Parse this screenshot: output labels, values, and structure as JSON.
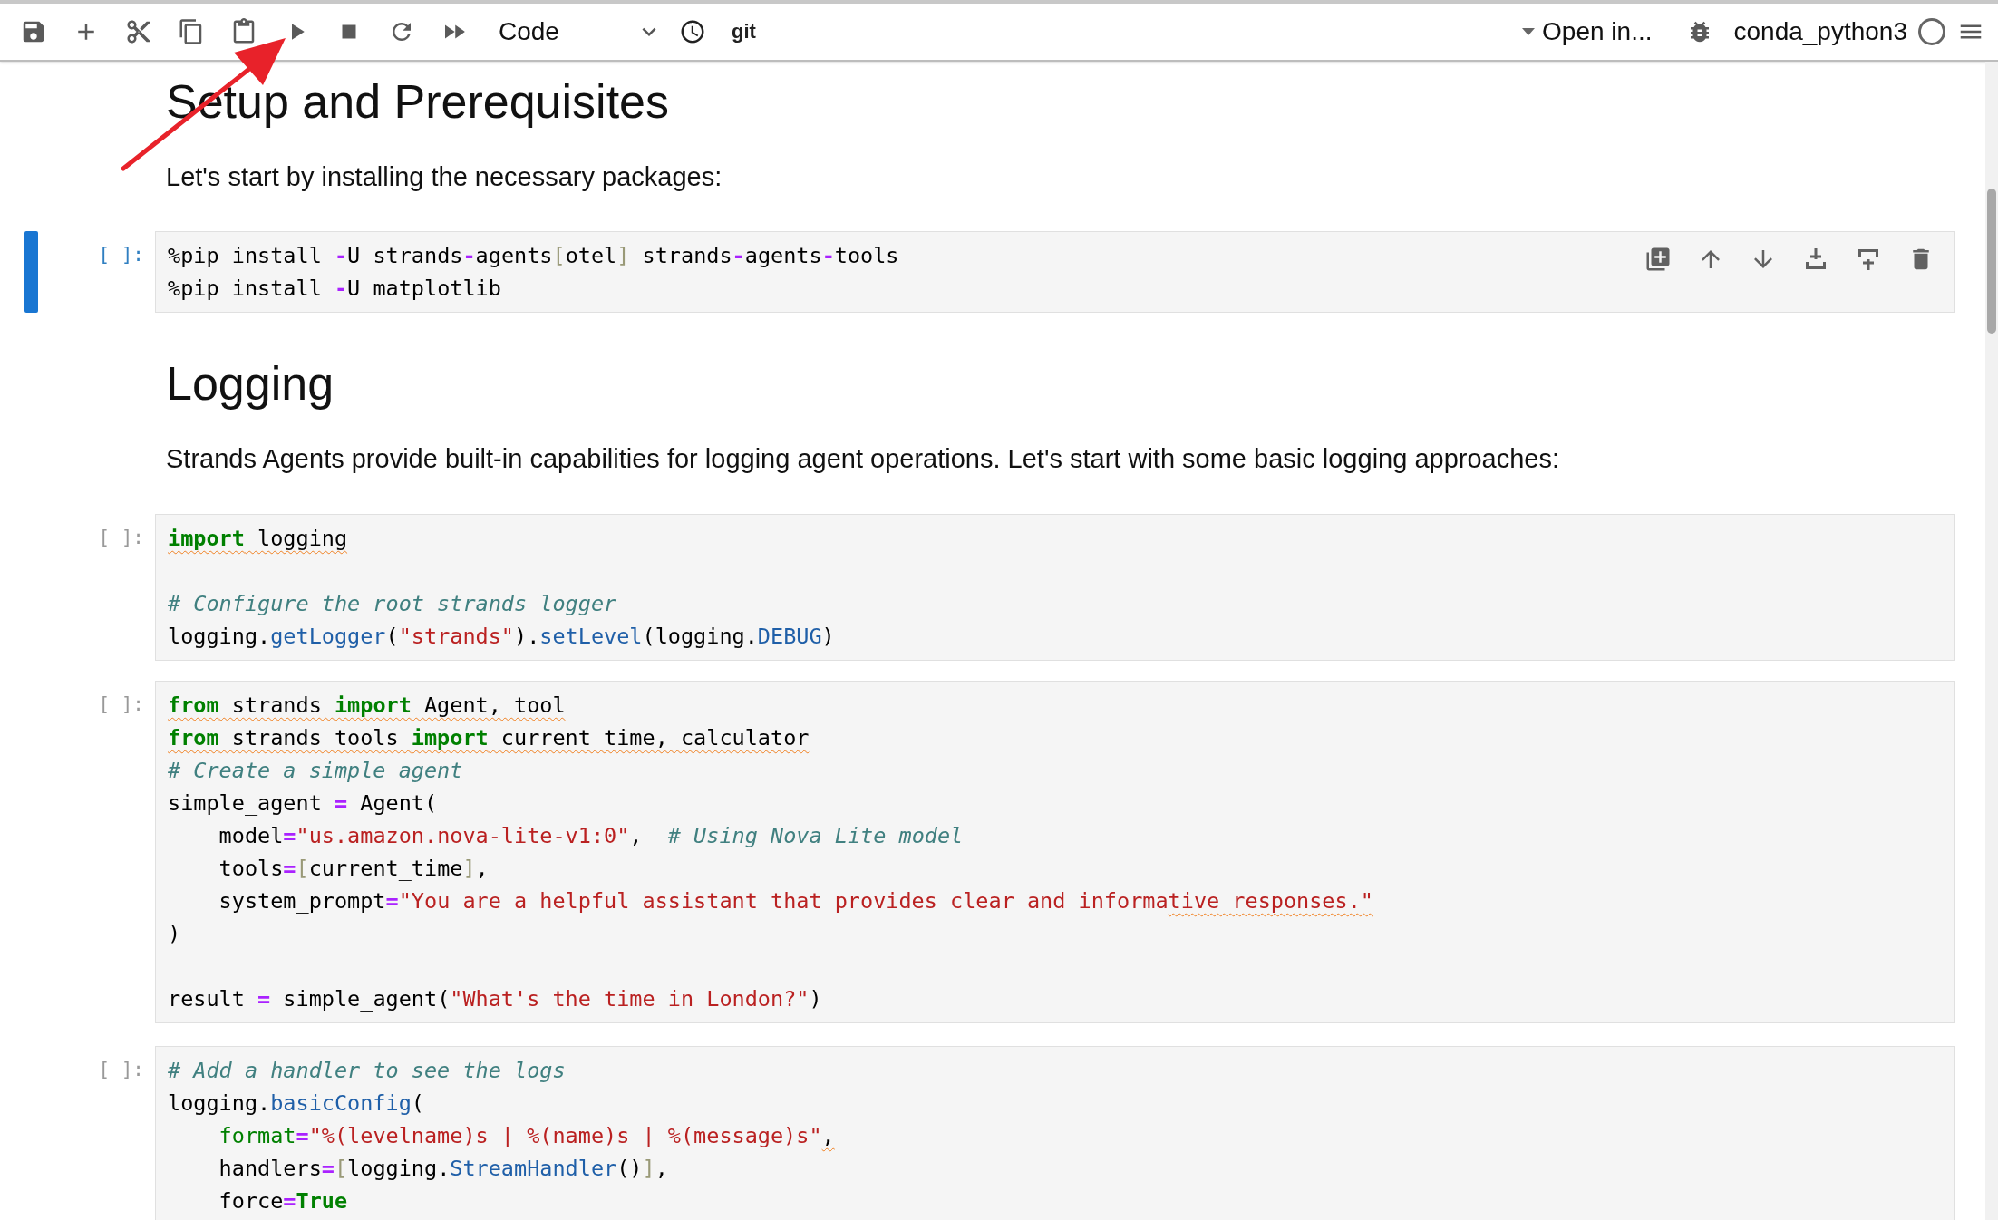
{
  "toolbar": {
    "cell_type": "Code",
    "git": "git",
    "open_in": "Open in...",
    "kernel": "conda_python3",
    "kernel_busy": false
  },
  "cells": [
    {
      "kind": "markdown",
      "heading": "Setup and Prerequisites",
      "text": "Let's start by installing the necessary packages:"
    },
    {
      "kind": "code",
      "prompt": "[ ]:",
      "active": true,
      "lines": [
        {
          "kind": "code",
          "tokens": [
            {
              "text": "%pip install ",
              "kind": "plain",
              "squiggle": false
            },
            {
              "text": "-",
              "kind": "op",
              "squiggle": false
            },
            {
              "text": "U strands",
              "kind": "plain",
              "squiggle": false
            },
            {
              "text": "-",
              "kind": "op",
              "squiggle": false
            },
            {
              "text": "agents",
              "kind": "plain",
              "squiggle": false
            },
            {
              "text": "[",
              "kind": "bracket",
              "squiggle": false
            },
            {
              "text": "otel",
              "kind": "plain",
              "squiggle": false
            },
            {
              "text": "]",
              "kind": "bracket",
              "squiggle": false
            },
            {
              "text": " strands",
              "kind": "plain",
              "squiggle": false
            },
            {
              "text": "-",
              "kind": "op",
              "squiggle": false
            },
            {
              "text": "agents",
              "kind": "plain",
              "squiggle": false
            },
            {
              "text": "-",
              "kind": "op",
              "squiggle": false
            },
            {
              "text": "tools",
              "kind": "plain",
              "squiggle": false
            }
          ]
        },
        {
          "kind": "code",
          "tokens": [
            {
              "text": "%pip install ",
              "kind": "plain",
              "squiggle": false
            },
            {
              "text": "-",
              "kind": "op",
              "squiggle": false
            },
            {
              "text": "U matplotlib",
              "kind": "plain",
              "squiggle": false
            }
          ]
        }
      ]
    },
    {
      "kind": "markdown",
      "heading": "Logging",
      "text": "Strands Agents provide built-in capabilities for logging agent operations. Let's start with some basic logging approaches:"
    },
    {
      "kind": "code",
      "prompt": "[ ]:",
      "active": false,
      "lines": [
        {
          "kind": "code",
          "tokens": [
            {
              "text": "import",
              "kind": "keyword",
              "squiggle": true
            },
            {
              "text": " logging",
              "kind": "plain",
              "squiggle": true
            }
          ]
        },
        {
          "kind": "blank"
        },
        {
          "kind": "code",
          "tokens": [
            {
              "text": "# Configure the root strands logger",
              "kind": "comment",
              "squiggle": false
            }
          ]
        },
        {
          "kind": "code",
          "tokens": [
            {
              "text": "logging.",
              "kind": "plain",
              "squiggle": false
            },
            {
              "text": "getLogger",
              "kind": "function",
              "squiggle": false
            },
            {
              "text": "(",
              "kind": "plain",
              "squiggle": false
            },
            {
              "text": "\"strands\"",
              "kind": "string",
              "squiggle": false
            },
            {
              "text": ").",
              "kind": "plain",
              "squiggle": false
            },
            {
              "text": "setLevel",
              "kind": "function",
              "squiggle": false
            },
            {
              "text": "(logging.",
              "kind": "plain",
              "squiggle": false
            },
            {
              "text": "DEBUG",
              "kind": "function",
              "squiggle": false
            },
            {
              "text": ")",
              "kind": "plain",
              "squiggle": false
            }
          ]
        }
      ]
    },
    {
      "kind": "code",
      "prompt": "[ ]:",
      "active": false,
      "lines": [
        {
          "kind": "code",
          "tokens": [
            {
              "text": "from",
              "kind": "keyword",
              "squiggle": true
            },
            {
              "text": " strands ",
              "kind": "plain",
              "squiggle": true
            },
            {
              "text": "import",
              "kind": "keyword",
              "squiggle": true
            },
            {
              "text": " Agent, tool",
              "kind": "plain",
              "squiggle": true
            }
          ]
        },
        {
          "kind": "code",
          "tokens": [
            {
              "text": "from",
              "kind": "keyword",
              "squiggle": true
            },
            {
              "text": " strands_tools ",
              "kind": "plain",
              "squiggle": true
            },
            {
              "text": "import",
              "kind": "keyword",
              "squiggle": true
            },
            {
              "text": " current_time, calculator",
              "kind": "plain",
              "squiggle": true
            }
          ]
        },
        {
          "kind": "code",
          "tokens": [
            {
              "text": "# Create a simple agent",
              "kind": "comment",
              "squiggle": false
            }
          ]
        },
        {
          "kind": "code",
          "tokens": [
            {
              "text": "simple_agent ",
              "kind": "plain",
              "squiggle": false
            },
            {
              "text": "=",
              "kind": "op",
              "squiggle": false
            },
            {
              "text": " Agent(",
              "kind": "plain",
              "squiggle": false
            }
          ]
        },
        {
          "kind": "code",
          "tokens": [
            {
              "text": "    model",
              "kind": "plain",
              "squiggle": false
            },
            {
              "text": "=",
              "kind": "op",
              "squiggle": false
            },
            {
              "text": "\"us.amazon.nova-lite-v1:0\"",
              "kind": "string",
              "squiggle": false
            },
            {
              "text": ",  ",
              "kind": "plain",
              "squiggle": false
            },
            {
              "text": "# Using Nova Lite model",
              "kind": "comment",
              "squiggle": false
            }
          ]
        },
        {
          "kind": "code",
          "tokens": [
            {
              "text": "    tools",
              "kind": "plain",
              "squiggle": false
            },
            {
              "text": "=",
              "kind": "op",
              "squiggle": false
            },
            {
              "text": "[",
              "kind": "bracket",
              "squiggle": false
            },
            {
              "text": "current_time",
              "kind": "plain",
              "squiggle": false
            },
            {
              "text": "]",
              "kind": "bracket",
              "squiggle": false
            },
            {
              "text": ",",
              "kind": "plain",
              "squiggle": false
            }
          ]
        },
        {
          "kind": "code",
          "tokens": [
            {
              "text": "    system_prompt",
              "kind": "plain",
              "squiggle": false
            },
            {
              "text": "=",
              "kind": "op",
              "squiggle": false
            },
            {
              "text": "\"You are a helpful assistant that provides clear and informa",
              "kind": "string",
              "squiggle": false
            },
            {
              "text": "tive responses.\"",
              "kind": "string",
              "squiggle": true
            }
          ]
        },
        {
          "kind": "code",
          "tokens": [
            {
              "text": ")",
              "kind": "plain",
              "squiggle": false
            }
          ]
        },
        {
          "kind": "blank"
        },
        {
          "kind": "code",
          "tokens": [
            {
              "text": "result ",
              "kind": "plain",
              "squiggle": false
            },
            {
              "text": "=",
              "kind": "op",
              "squiggle": false
            },
            {
              "text": " simple_agent(",
              "kind": "plain",
              "squiggle": false
            },
            {
              "text": "\"What's the time in London?\"",
              "kind": "string",
              "squiggle": false
            },
            {
              "text": ")",
              "kind": "plain",
              "squiggle": false
            }
          ]
        }
      ]
    },
    {
      "kind": "code",
      "prompt": "[ ]:",
      "active": false,
      "lines": [
        {
          "kind": "code",
          "tokens": [
            {
              "text": "# Add a handler to see the logs",
              "kind": "comment",
              "squiggle": false
            }
          ]
        },
        {
          "kind": "code",
          "tokens": [
            {
              "text": "logging.",
              "kind": "plain",
              "squiggle": false
            },
            {
              "text": "basicConfig",
              "kind": "function",
              "squiggle": false
            },
            {
              "text": "(",
              "kind": "plain",
              "squiggle": false
            }
          ]
        },
        {
          "kind": "code",
          "tokens": [
            {
              "text": "    format",
              "kind": "builtin",
              "squiggle": false
            },
            {
              "text": "=",
              "kind": "op",
              "squiggle": false
            },
            {
              "text": "\"%(levelname)s | %(name)s | %(message)s\"",
              "kind": "string",
              "squiggle": false
            },
            {
              "text": ",",
              "kind": "plain",
              "squiggle": true
            }
          ]
        },
        {
          "kind": "code",
          "tokens": [
            {
              "text": "    handlers",
              "kind": "plain",
              "squiggle": false
            },
            {
              "text": "=",
              "kind": "op",
              "squiggle": false
            },
            {
              "text": "[",
              "kind": "bracket",
              "squiggle": false
            },
            {
              "text": "logging.",
              "kind": "plain",
              "squiggle": false
            },
            {
              "text": "StreamHandler",
              "kind": "function",
              "squiggle": false
            },
            {
              "text": "()",
              "kind": "plain",
              "squiggle": false
            },
            {
              "text": "]",
              "kind": "bracket",
              "squiggle": false
            },
            {
              "text": ",",
              "kind": "plain",
              "squiggle": false
            }
          ]
        },
        {
          "kind": "code",
          "tokens": [
            {
              "text": "    force",
              "kind": "plain",
              "squiggle": false
            },
            {
              "text": "=",
              "kind": "op",
              "squiggle": false
            },
            {
              "text": "True",
              "kind": "keyword",
              "squiggle": false
            }
          ]
        }
      ]
    }
  ]
}
